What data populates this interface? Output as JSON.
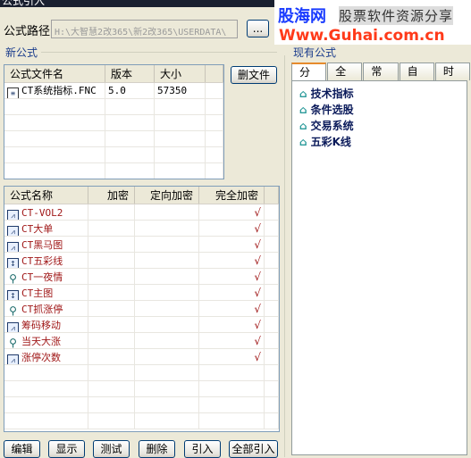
{
  "window": {
    "title": "公式引入"
  },
  "path": {
    "label": "公式路径",
    "value": "H:\\大智慧2改365\\新2改365\\USERDATA\\",
    "browse_label": "..."
  },
  "logo": {
    "name": "股海网",
    "slogan": "股票软件资源分享",
    "url": "Www.Guhai.com.cn"
  },
  "new_formula": {
    "group_label": "新公式",
    "file_columns": [
      "公式文件名",
      "版本",
      "大小"
    ],
    "files": [
      {
        "name": "CT系统指标.FNC",
        "version": "5.0",
        "size": "57350",
        "icon": "document-icon"
      }
    ],
    "delete_file_label": "删文件",
    "formula_columns": [
      "公式名称",
      "加密",
      "定向加密",
      "完全加密"
    ],
    "formulas": [
      {
        "name": "CT-VOL2",
        "icon": "chart-icon",
        "encrypt": "",
        "directed": "",
        "full": "√"
      },
      {
        "name": "CT大单",
        "icon": "chart-icon",
        "encrypt": "",
        "directed": "",
        "full": "√"
      },
      {
        "name": "CT黑马图",
        "icon": "chart-icon",
        "encrypt": "",
        "directed": "",
        "full": "√"
      },
      {
        "name": "CT五彩线",
        "icon": "kline-icon",
        "encrypt": "",
        "directed": "",
        "full": "√"
      },
      {
        "name": "CT一夜情",
        "icon": "binoculars-icon",
        "encrypt": "",
        "directed": "",
        "full": "√"
      },
      {
        "name": "CT主图",
        "icon": "kline-icon",
        "encrypt": "",
        "directed": "",
        "full": "√"
      },
      {
        "name": "CT抓涨停",
        "icon": "binoculars-icon",
        "encrypt": "",
        "directed": "",
        "full": "√"
      },
      {
        "name": "筹码移动",
        "icon": "chart-icon",
        "encrypt": "",
        "directed": "",
        "full": "√"
      },
      {
        "name": "当天大涨",
        "icon": "binoculars-icon",
        "encrypt": "",
        "directed": "",
        "full": "√"
      },
      {
        "name": "涨停次数",
        "icon": "chart-icon",
        "encrypt": "",
        "directed": "",
        "full": "√"
      }
    ]
  },
  "buttons": {
    "edit": "编辑",
    "show": "显示",
    "test": "测试",
    "delete": "删除",
    "import": "引入",
    "import_all": "全部引入"
  },
  "existing": {
    "group_label": "现有公式",
    "tabs": [
      "分组",
      "全部",
      "常用",
      "自编",
      "时间"
    ],
    "active_tab": "分组",
    "tree": [
      "技术指标",
      "条件选股",
      "交易系统",
      "五彩K线"
    ]
  }
}
